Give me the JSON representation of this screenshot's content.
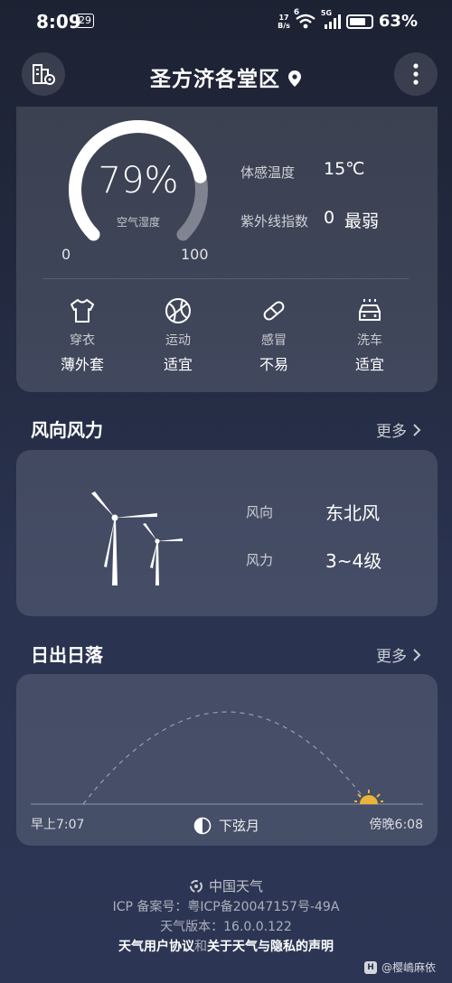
{
  "status": {
    "time": "8:09",
    "date_badge": "29",
    "net_speed_value": "17",
    "net_speed_unit": "B/s",
    "wifi_label": "6",
    "signal_label": "5G",
    "battery": "63%"
  },
  "header": {
    "city": "圣方济各堂区",
    "left_icon": "city-manage-icon",
    "right_icon": "more-vert-icon"
  },
  "overview": {
    "humidity_value": "79%",
    "humidity_label": "空气湿度",
    "humidity_fraction": 0.79,
    "scale_min": "0",
    "scale_max": "100",
    "feels_like_label": "体感温度",
    "feels_like_value": "15℃",
    "uv_label": "紫外线指数",
    "uv_value": "0",
    "uv_level": "最弱",
    "life_index": [
      {
        "icon": "shirt-icon",
        "name": "穿衣",
        "value": "薄外套"
      },
      {
        "icon": "sport-ball-icon",
        "name": "运动",
        "value": "适宜"
      },
      {
        "icon": "pill-icon",
        "name": "感冒",
        "value": "不易"
      },
      {
        "icon": "car-wash-icon",
        "name": "洗车",
        "value": "适宜"
      }
    ]
  },
  "wind": {
    "title": "风向风力",
    "more": "更多",
    "direction_label": "风向",
    "direction_value": "东北风",
    "force_label": "风力",
    "force_value": "3~4级"
  },
  "sun": {
    "title": "日出日落",
    "more": "更多",
    "sunrise": "早上7:07",
    "sunset": "傍晚6:08",
    "moon_phase": "下弦月",
    "day_progress": 1.0
  },
  "footer": {
    "brand": "中国天气",
    "icp": "ICP 备案号：粤ICP备20047157号-49A",
    "version": "天气版本：16.0.0.122",
    "agreement": "天气用户协议",
    "and": "和",
    "privacy": "关于天气与隐私的声明"
  },
  "watermark": {
    "logo": "H",
    "text": "@樱嶋麻依"
  },
  "colors": {
    "sun": "#e8b43a",
    "gauge_track": "rgba(255,255,255,0.35)",
    "gauge_fill": "#ffffff"
  }
}
